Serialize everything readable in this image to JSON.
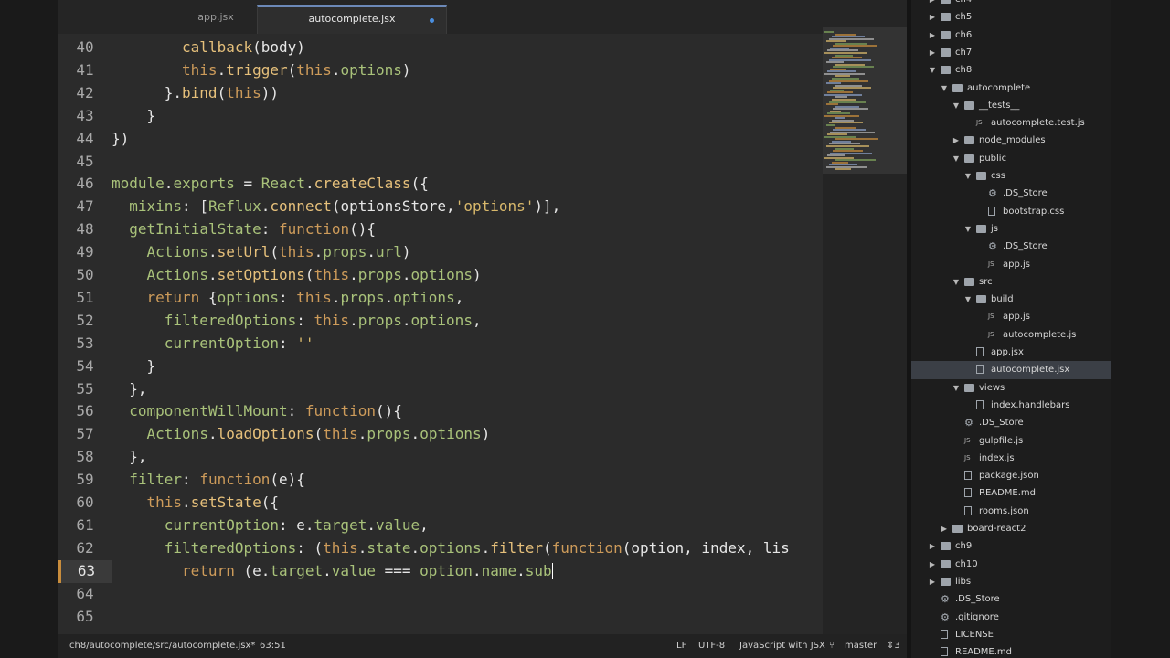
{
  "tabs": [
    {
      "label": "app.jsx",
      "active": false
    },
    {
      "label": "autocomplete.jsx",
      "active": true,
      "modified": true
    }
  ],
  "editor": {
    "lines": [
      {
        "num": "40",
        "indent": 4,
        "tokens": [
          [
            "f",
            "callback"
          ],
          [
            "w",
            "(body)"
          ]
        ]
      },
      {
        "num": "41",
        "indent": 4,
        "tokens": [
          [
            "k",
            "this"
          ],
          [
            "w",
            "."
          ],
          [
            "f",
            "trigger"
          ],
          [
            "w",
            "("
          ],
          [
            "k",
            "this"
          ],
          [
            "w",
            "."
          ],
          [
            "p",
            "options"
          ],
          [
            "w",
            ")"
          ]
        ]
      },
      {
        "num": "42",
        "indent": 3,
        "tokens": [
          [
            "w",
            "}."
          ],
          [
            "f",
            "bind"
          ],
          [
            "w",
            "("
          ],
          [
            "k",
            "this"
          ],
          [
            "w",
            "))"
          ]
        ]
      },
      {
        "num": "43",
        "indent": 2,
        "tokens": [
          [
            "w",
            "}"
          ]
        ]
      },
      {
        "num": "44",
        "indent": 0,
        "tokens": [
          [
            "w",
            "})"
          ]
        ]
      },
      {
        "num": "45",
        "indent": 0,
        "tokens": []
      },
      {
        "num": "46",
        "indent": 0,
        "tokens": [
          [
            "p",
            "module"
          ],
          [
            "w",
            "."
          ],
          [
            "p",
            "exports"
          ],
          [
            "w",
            " = "
          ],
          [
            "p",
            "React"
          ],
          [
            "w",
            "."
          ],
          [
            "f",
            "createClass"
          ],
          [
            "w",
            "({"
          ]
        ]
      },
      {
        "num": "47",
        "indent": 1,
        "tokens": [
          [
            "p",
            "mixins"
          ],
          [
            "w",
            ": ["
          ],
          [
            "p",
            "Reflux"
          ],
          [
            "w",
            "."
          ],
          [
            "f",
            "connect"
          ],
          [
            "w",
            "(optionsStore,"
          ],
          [
            "s",
            "'options'"
          ],
          [
            "w",
            ")],"
          ]
        ]
      },
      {
        "num": "48",
        "indent": 1,
        "tokens": [
          [
            "p",
            "getInitialState"
          ],
          [
            "w",
            ": "
          ],
          [
            "k",
            "function"
          ],
          [
            "w",
            "(){"
          ]
        ]
      },
      {
        "num": "49",
        "indent": 2,
        "tokens": [
          [
            "p",
            "Actions"
          ],
          [
            "w",
            "."
          ],
          [
            "f",
            "setUrl"
          ],
          [
            "w",
            "("
          ],
          [
            "k",
            "this"
          ],
          [
            "w",
            "."
          ],
          [
            "p",
            "props"
          ],
          [
            "w",
            "."
          ],
          [
            "p",
            "url"
          ],
          [
            "w",
            ")"
          ]
        ]
      },
      {
        "num": "50",
        "indent": 2,
        "tokens": [
          [
            "p",
            "Actions"
          ],
          [
            "w",
            "."
          ],
          [
            "f",
            "setOptions"
          ],
          [
            "w",
            "("
          ],
          [
            "k",
            "this"
          ],
          [
            "w",
            "."
          ],
          [
            "p",
            "props"
          ],
          [
            "w",
            "."
          ],
          [
            "p",
            "options"
          ],
          [
            "w",
            ")"
          ]
        ]
      },
      {
        "num": "51",
        "indent": 2,
        "tokens": [
          [
            "k",
            "return"
          ],
          [
            "w",
            " {"
          ],
          [
            "p",
            "options"
          ],
          [
            "w",
            ": "
          ],
          [
            "k",
            "this"
          ],
          [
            "w",
            "."
          ],
          [
            "p",
            "props"
          ],
          [
            "w",
            "."
          ],
          [
            "p",
            "options"
          ],
          [
            "w",
            ","
          ]
        ]
      },
      {
        "num": "52",
        "indent": 3,
        "tokens": [
          [
            "p",
            "filteredOptions"
          ],
          [
            "w",
            ": "
          ],
          [
            "k",
            "this"
          ],
          [
            "w",
            "."
          ],
          [
            "p",
            "props"
          ],
          [
            "w",
            "."
          ],
          [
            "p",
            "options"
          ],
          [
            "w",
            ","
          ]
        ]
      },
      {
        "num": "53",
        "indent": 3,
        "tokens": [
          [
            "p",
            "currentOption"
          ],
          [
            "w",
            ": "
          ],
          [
            "s",
            "''"
          ]
        ]
      },
      {
        "num": "54",
        "indent": 2,
        "tokens": [
          [
            "w",
            "}"
          ]
        ]
      },
      {
        "num": "55",
        "indent": 1,
        "tokens": [
          [
            "w",
            "},"
          ]
        ]
      },
      {
        "num": "56",
        "indent": 1,
        "tokens": [
          [
            "p",
            "componentWillMount"
          ],
          [
            "w",
            ": "
          ],
          [
            "k",
            "function"
          ],
          [
            "w",
            "(){"
          ]
        ]
      },
      {
        "num": "57",
        "indent": 2,
        "tokens": [
          [
            "p",
            "Actions"
          ],
          [
            "w",
            "."
          ],
          [
            "f",
            "loadOptions"
          ],
          [
            "w",
            "("
          ],
          [
            "k",
            "this"
          ],
          [
            "w",
            "."
          ],
          [
            "p",
            "props"
          ],
          [
            "w",
            "."
          ],
          [
            "p",
            "options"
          ],
          [
            "w",
            ")"
          ]
        ]
      },
      {
        "num": "58",
        "indent": 1,
        "tokens": [
          [
            "w",
            "},"
          ]
        ]
      },
      {
        "num": "59",
        "indent": 1,
        "tokens": [
          [
            "p",
            "filter"
          ],
          [
            "w",
            ": "
          ],
          [
            "k",
            "function"
          ],
          [
            "w",
            "(e){"
          ]
        ]
      },
      {
        "num": "60",
        "indent": 2,
        "tokens": [
          [
            "k",
            "this"
          ],
          [
            "w",
            "."
          ],
          [
            "f",
            "setState"
          ],
          [
            "w",
            "({"
          ]
        ]
      },
      {
        "num": "61",
        "indent": 3,
        "tokens": [
          [
            "p",
            "currentOption"
          ],
          [
            "w",
            ": e."
          ],
          [
            "p",
            "target"
          ],
          [
            "w",
            "."
          ],
          [
            "p",
            "value"
          ],
          [
            "w",
            ","
          ]
        ]
      },
      {
        "num": "62",
        "indent": 3,
        "tokens": [
          [
            "p",
            "filteredOptions"
          ],
          [
            "w",
            ": ("
          ],
          [
            "k",
            "this"
          ],
          [
            "w",
            "."
          ],
          [
            "p",
            "state"
          ],
          [
            "w",
            "."
          ],
          [
            "p",
            "options"
          ],
          [
            "w",
            "."
          ],
          [
            "f",
            "filter"
          ],
          [
            "w",
            "("
          ],
          [
            "k",
            "function"
          ],
          [
            "w",
            "(option, index, lis"
          ]
        ]
      },
      {
        "num": "63",
        "indent": 4,
        "active": true,
        "tokens": [
          [
            "k",
            "return"
          ],
          [
            "w",
            " (e."
          ],
          [
            "p",
            "target"
          ],
          [
            "w",
            "."
          ],
          [
            "p",
            "value"
          ],
          [
            "w",
            " === "
          ],
          [
            "p",
            "option"
          ],
          [
            "w",
            "."
          ],
          [
            "p",
            "name"
          ],
          [
            "w",
            "."
          ],
          [
            "p",
            "sub"
          ]
        ]
      },
      {
        "num": "64",
        "indent": 0,
        "tokens": []
      },
      {
        "num": "65",
        "indent": 0,
        "tokens": []
      }
    ]
  },
  "status": {
    "path": "ch8/autocomplete/src/autocomplete.jsx*",
    "cursor": "63:51",
    "line_ending": "LF",
    "encoding": "UTF-8",
    "syntax": "JavaScript with JSX",
    "branch": "master",
    "branch_count": "3"
  },
  "tree": [
    {
      "label": "ch4",
      "depth": 0,
      "type": "folder",
      "arrow": "right"
    },
    {
      "label": "ch5",
      "depth": 0,
      "type": "folder",
      "arrow": "right"
    },
    {
      "label": "ch6",
      "depth": 0,
      "type": "folder",
      "arrow": "right"
    },
    {
      "label": "ch7",
      "depth": 0,
      "type": "folder",
      "arrow": "right"
    },
    {
      "label": "ch8",
      "depth": 0,
      "type": "folder",
      "arrow": "down"
    },
    {
      "label": "autocomplete",
      "depth": 1,
      "type": "folder",
      "arrow": "down"
    },
    {
      "label": "__tests__",
      "depth": 2,
      "type": "folder",
      "arrow": "down"
    },
    {
      "label": "autocomplete.test.js",
      "depth": 3,
      "type": "js"
    },
    {
      "label": "node_modules",
      "depth": 2,
      "type": "folder",
      "arrow": "right"
    },
    {
      "label": "public",
      "depth": 2,
      "type": "folder",
      "arrow": "down"
    },
    {
      "label": "css",
      "depth": 3,
      "type": "folder",
      "arrow": "down"
    },
    {
      "label": ".DS_Store",
      "depth": 4,
      "type": "gear"
    },
    {
      "label": "bootstrap.css",
      "depth": 4,
      "type": "file"
    },
    {
      "label": "js",
      "depth": 3,
      "type": "folder",
      "arrow": "down"
    },
    {
      "label": ".DS_Store",
      "depth": 4,
      "type": "gear"
    },
    {
      "label": "app.js",
      "depth": 4,
      "type": "js"
    },
    {
      "label": "src",
      "depth": 2,
      "type": "folder",
      "arrow": "down"
    },
    {
      "label": "build",
      "depth": 3,
      "type": "folder",
      "arrow": "down"
    },
    {
      "label": "app.js",
      "depth": 4,
      "type": "js"
    },
    {
      "label": "autocomplete.js",
      "depth": 4,
      "type": "js"
    },
    {
      "label": "app.jsx",
      "depth": 3,
      "type": "file"
    },
    {
      "label": "autocomplete.jsx",
      "depth": 3,
      "type": "file",
      "selected": true
    },
    {
      "label": "views",
      "depth": 2,
      "type": "folder",
      "arrow": "down"
    },
    {
      "label": "index.handlebars",
      "depth": 3,
      "type": "file"
    },
    {
      "label": ".DS_Store",
      "depth": 2,
      "type": "gear"
    },
    {
      "label": "gulpfile.js",
      "depth": 2,
      "type": "js"
    },
    {
      "label": "index.js",
      "depth": 2,
      "type": "js"
    },
    {
      "label": "package.json",
      "depth": 2,
      "type": "file"
    },
    {
      "label": "README.md",
      "depth": 2,
      "type": "file"
    },
    {
      "label": "rooms.json",
      "depth": 2,
      "type": "file"
    },
    {
      "label": "board-react2",
      "depth": 1,
      "type": "folder",
      "arrow": "right"
    },
    {
      "label": "ch9",
      "depth": 0,
      "type": "folder",
      "arrow": "right"
    },
    {
      "label": "ch10",
      "depth": 0,
      "type": "folder",
      "arrow": "right"
    },
    {
      "label": "libs",
      "depth": 0,
      "type": "folder",
      "arrow": "right"
    },
    {
      "label": ".DS_Store",
      "depth": 0,
      "type": "gear"
    },
    {
      "label": ".gitignore",
      "depth": 0,
      "type": "gear"
    },
    {
      "label": "LICENSE",
      "depth": 0,
      "type": "file"
    },
    {
      "label": "README.md",
      "depth": 0,
      "type": "file"
    }
  ]
}
